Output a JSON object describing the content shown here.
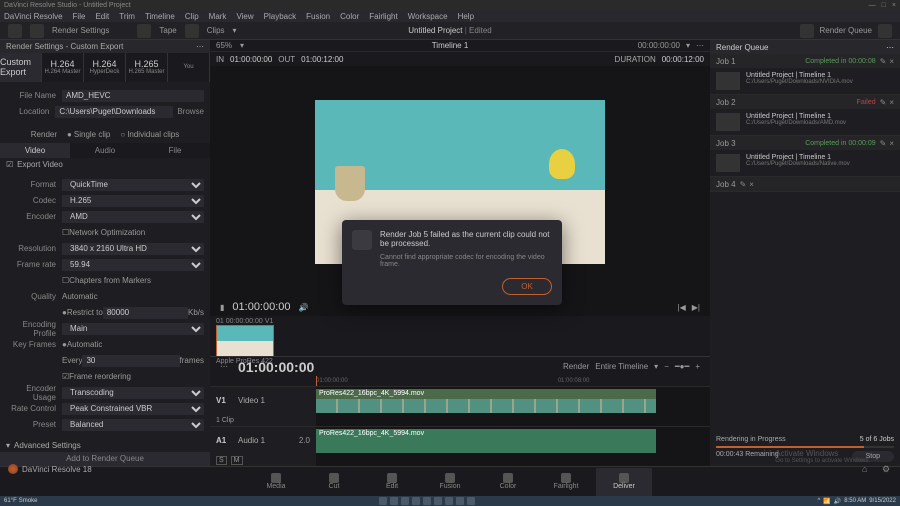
{
  "titlebar": {
    "app": "DaVinci Resolve Studio - Untitled Project"
  },
  "menubar": [
    "DaVinci Resolve",
    "File",
    "Edit",
    "Trim",
    "Timeline",
    "Clip",
    "Mark",
    "View",
    "Playback",
    "Fusion",
    "Color",
    "Fairlight",
    "Workspace",
    "Help"
  ],
  "toolbar": {
    "render_settings": "Render Settings",
    "tape": "Tape",
    "clips": "Clips",
    "project": "Untitled Project",
    "edited": "Edited",
    "render_queue": "Render Queue"
  },
  "left": {
    "header": "Render Settings - Custom Export",
    "presets": [
      {
        "title": "Custom Export",
        "sub": ""
      },
      {
        "title": "H.264",
        "sub": "H.264 Master"
      },
      {
        "title": "H.264",
        "sub": "HyperDeck"
      },
      {
        "title": "H.265",
        "sub": "H.265 Master"
      },
      {
        "title": "",
        "sub": "You"
      }
    ],
    "filename_label": "File Name",
    "filename_value": "AMD_HEVC",
    "location_label": "Location",
    "location_value": "C:\\Users\\Puget\\Downloads",
    "browse": "Browse",
    "render_label": "Render",
    "single_clip": "Single clip",
    "individual_clips": "Individual clips",
    "tabs": [
      "Video",
      "Audio",
      "File"
    ],
    "export_video": "Export Video",
    "format_label": "Format",
    "format_value": "QuickTime",
    "codec_label": "Codec",
    "codec_value": "H.265",
    "encoder_label": "Encoder",
    "encoder_value": "AMD",
    "netopt": "Network Optimization",
    "resolution_label": "Resolution",
    "resolution_value": "3840 x 2160 Ultra HD",
    "framerate_label": "Frame rate",
    "framerate_value": "59.94",
    "chapters": "Chapters from Markers",
    "quality_label": "Quality",
    "quality_value": "Automatic",
    "restrict": "Restrict to",
    "restrict_value": "80000",
    "kbps": "Kb/s",
    "encprofile_label": "Encoding Profile",
    "encprofile_value": "Main",
    "keyframes_label": "Key Frames",
    "keyframes_auto": "Automatic",
    "keyframes_every": "Every",
    "keyframes_value": "30",
    "keyframes_frames": "frames",
    "frame_reorder": "Frame reordering",
    "encusage_label": "Encoder Usage",
    "encusage_value": "Transcoding",
    "ratecontrol_label": "Rate Control",
    "ratecontrol_value": "Peak Constrained VBR",
    "preset_label": "Preset",
    "preset_value": "Balanced",
    "advanced": "Advanced Settings",
    "add_queue": "Add to Render Queue"
  },
  "center": {
    "zoom": "65%",
    "timeline_name": "Timeline 1",
    "tc_display": "00:00:00:00",
    "in_label": "IN",
    "in_value": "01:00:00:00",
    "out_label": "OUT",
    "out_value": "01:00:12:00",
    "duration_label": "DURATION",
    "duration_value": "00:00:12:00",
    "viewer_tc": "01:00:00:00",
    "clip01": "01",
    "clip_tc": "00:00:00:00",
    "clip_v": "V1",
    "clip_name": "Apple ProRes 422",
    "render_label": "Render",
    "render_scope": "Entire Timeline",
    "timeline_tc": "01:00:00:00",
    "ruler_tc1": "01:00:00:00",
    "ruler_tc2": "01:00:08:00",
    "v1": "V1",
    "v1_name": "Video 1",
    "v1_sub": "1 Clip",
    "a1": "A1",
    "a1_name": "Audio 1",
    "a1_val": "2.0",
    "a1_s": "S",
    "a1_m": "M",
    "clip_filename": "ProRes422_16bpc_4K_5994.mov"
  },
  "queue": {
    "header": "Render Queue",
    "jobs": [
      {
        "id": "Job 1",
        "status": "Completed in 00:00:08",
        "status_class": "completed",
        "title": "Untitled Project | Timeline 1",
        "path": "C:/Users/Puget/Downloads/NVIDIA.mov"
      },
      {
        "id": "Job 2",
        "status": "Failed",
        "status_class": "failed",
        "title": "Untitled Project | Timeline 1",
        "path": "C:/Users/Puget/Downloads/AMD.mov"
      },
      {
        "id": "Job 3",
        "status": "Completed in 00:00:09",
        "status_class": "completed",
        "title": "Untitled Project | Timeline 1",
        "path": "C:/Users/Puget/Downloads/Native.mov"
      },
      {
        "id": "Job 4",
        "status": "",
        "status_class": "progress",
        "title": "",
        "path": ""
      }
    ],
    "progress_label": "Rendering in Progress",
    "progress_count": "5 of 6 Jobs",
    "remaining": "00:00:43 Remaining",
    "stop": "Stop"
  },
  "modal": {
    "title": "Render Job 5 failed as the current clip could not be processed.",
    "sub": "Cannot find appropriate codec for encoding the video frame.",
    "ok": "OK"
  },
  "nav": [
    "Media",
    "Cut",
    "Edit",
    "Fusion",
    "Color",
    "Fairlight",
    "Deliver"
  ],
  "app_name": "DaVinci Resolve 18",
  "activate": {
    "title": "Activate Windows",
    "sub": "Go to Settings to activate Windows."
  },
  "taskbar": {
    "weather": "61°F",
    "weather_sub": "Smoke",
    "time": "8:50 AM",
    "date": "9/15/2022"
  }
}
